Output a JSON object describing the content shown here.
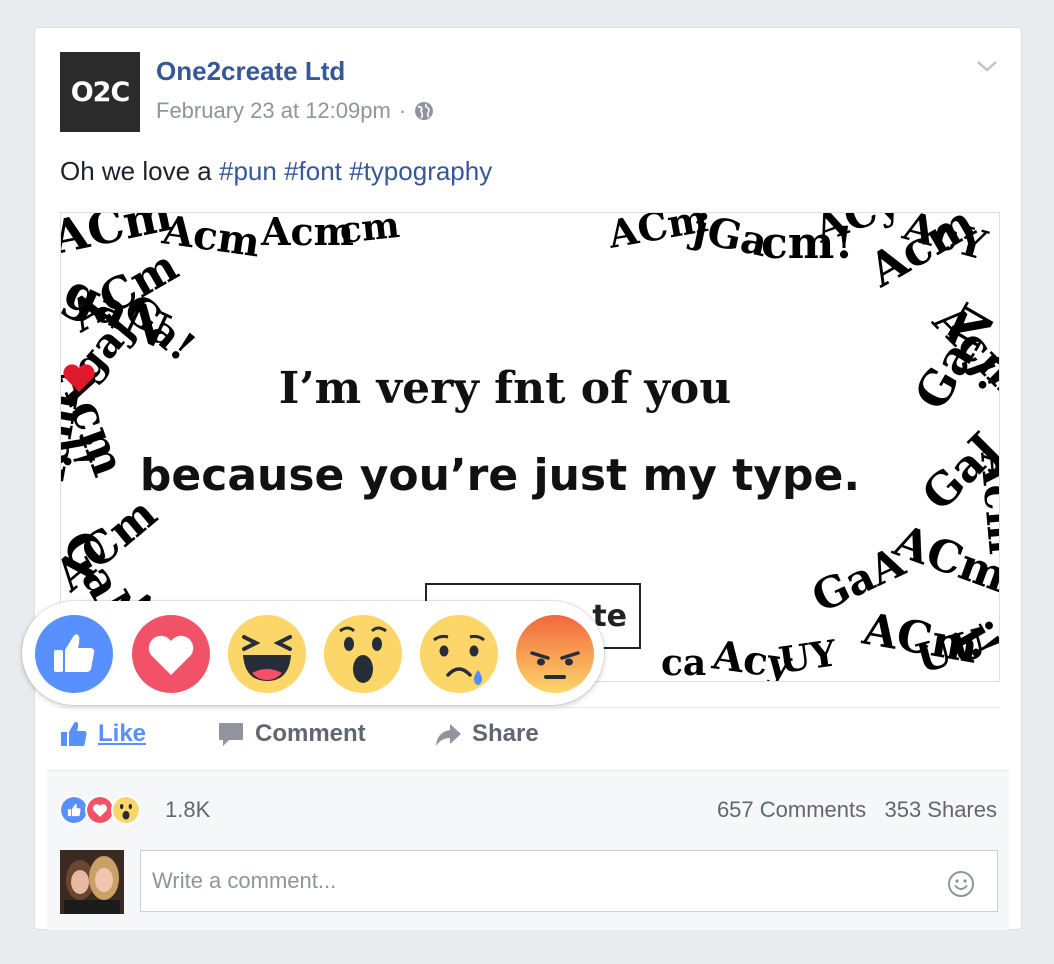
{
  "post": {
    "logo_text": "O2C",
    "page_name": "One2create Ltd",
    "timestamp": "February 23 at 12:09pm",
    "separator": "·",
    "text_prefix": "Oh we love a",
    "hashtags": [
      "#pun",
      "#font",
      "#typography"
    ]
  },
  "image": {
    "line1_a": "I’m very f",
    "line1_b": "nt of you",
    "line2": "because you’re just my type.",
    "logo_fragment": "te"
  },
  "reactions": [
    "like",
    "love",
    "haha",
    "wow",
    "sad",
    "angry"
  ],
  "actions": {
    "like": "Like",
    "comment": "Comment",
    "share": "Share"
  },
  "summary": {
    "reaction_count": "1.8K",
    "comments": "657 Comments",
    "shares": "353 Shares"
  },
  "comment_box": {
    "placeholder": "Write a comment..."
  },
  "colors": {
    "link": "#365899",
    "like_blue": "#5890ff",
    "love_red": "#f25268",
    "emoji_yellow": "#fcd669",
    "angry_red": "#f2673d"
  }
}
